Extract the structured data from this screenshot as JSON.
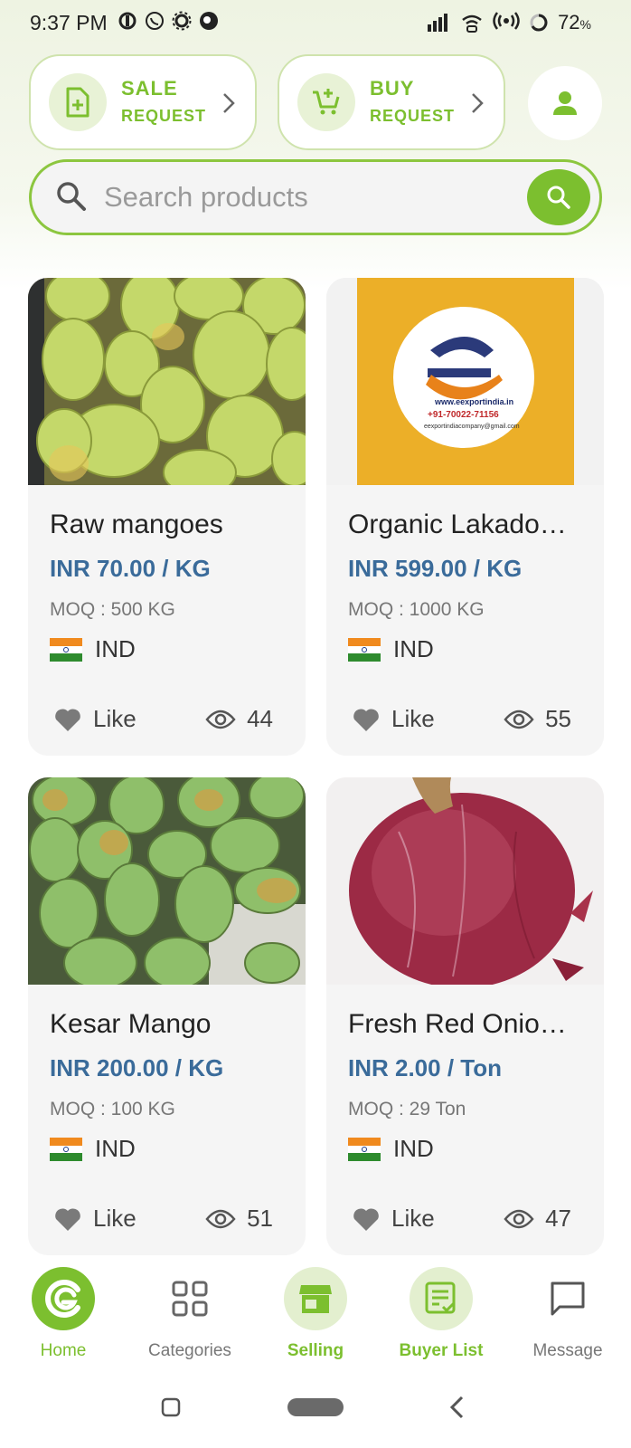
{
  "status_bar": {
    "time": "9:37 PM",
    "battery": "72",
    "battery_unit": "%"
  },
  "header": {
    "sale_request": {
      "line1": "SALE",
      "line2": "REQUEST"
    },
    "buy_request": {
      "line1": "BUY",
      "line2": "REQUEST"
    }
  },
  "search": {
    "placeholder": "Search products"
  },
  "products": [
    {
      "name": "Raw mangoes",
      "price": "INR 70.00 / KG",
      "moq": "MOQ : 500 KG",
      "country": "IND",
      "like_label": "Like",
      "views": "44",
      "image": "raw-mangoes-photo"
    },
    {
      "name": "Organic Lakado…",
      "price": "INR 599.00 / KG",
      "moq": "MOQ : 1000 KG",
      "country": "IND",
      "like_label": "Like",
      "views": "55",
      "image": "turmeric-pack-photo",
      "pack_label": {
        "site": "www.eexportindia.in",
        "phone": "+91-70022-71156",
        "email": "eexportindiacompany@gmail.com"
      }
    },
    {
      "name": "Kesar Mango",
      "price": "INR 200.00 / KG",
      "moq": "MOQ : 100 KG",
      "country": "IND",
      "like_label": "Like",
      "views": "51",
      "image": "kesar-mango-photo"
    },
    {
      "name": "Fresh  Red Onio…",
      "price": "INR 2.00 / Ton",
      "moq": "MOQ : 29 Ton",
      "country": "IND",
      "like_label": "Like",
      "views": "47",
      "image": "red-onion-photo"
    }
  ],
  "bottom_nav": [
    {
      "label": "Home",
      "icon": "home-logo-icon",
      "active": true
    },
    {
      "label": "Categories",
      "icon": "grid-icon",
      "active": false
    },
    {
      "label": "Selling",
      "icon": "store-icon",
      "active": false
    },
    {
      "label": "Buyer List",
      "icon": "list-check-icon",
      "active": false
    },
    {
      "label": "Message",
      "icon": "chat-icon",
      "active": false
    }
  ],
  "colors": {
    "accent": "#7cbf2f",
    "price": "#3a6b9a",
    "card_bg": "#f5f5f5"
  }
}
